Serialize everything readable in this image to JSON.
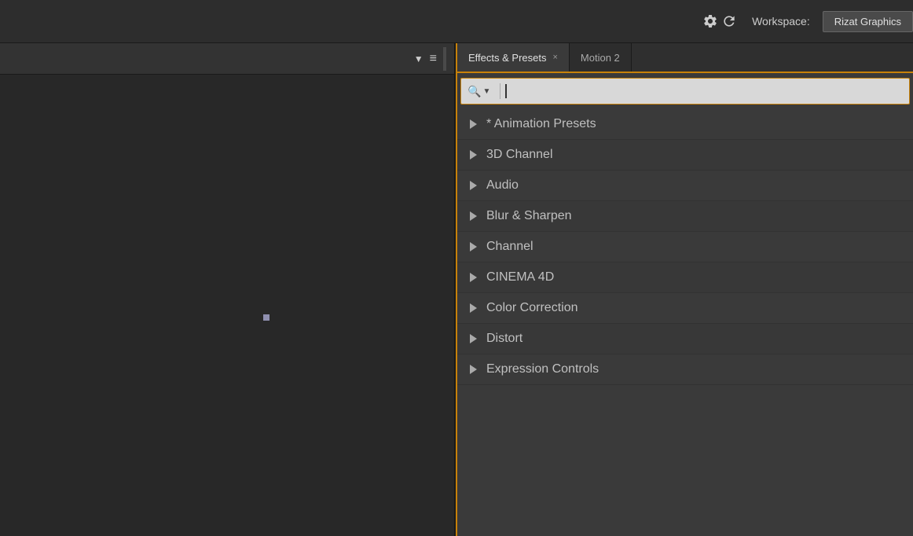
{
  "header": {
    "workspace_label": "Workspace:",
    "workspace_button": "Rizat Graphics",
    "gear_icon": "⚙",
    "refresh_icon": "↺"
  },
  "left_panel": {
    "menu_icon": "▼",
    "list_icon": "≡"
  },
  "tabs": [
    {
      "id": "effects",
      "label": "Effects & Presets",
      "active": true,
      "closable": true
    },
    {
      "id": "motion2",
      "label": "Motion 2",
      "active": false,
      "closable": false
    }
  ],
  "search": {
    "placeholder": "",
    "search_icon": "🔍",
    "dropdown_arrow": "▼"
  },
  "effects_list": [
    {
      "id": "animation-presets",
      "label": "* Animation Presets"
    },
    {
      "id": "3d-channel",
      "label": "3D Channel"
    },
    {
      "id": "audio",
      "label": "Audio"
    },
    {
      "id": "blur-sharpen",
      "label": "Blur & Sharpen"
    },
    {
      "id": "channel",
      "label": "Channel"
    },
    {
      "id": "cinema-4d",
      "label": "CINEMA 4D"
    },
    {
      "id": "color-correction",
      "label": "Color Correction"
    },
    {
      "id": "distort",
      "label": "Distort"
    },
    {
      "id": "expression-controls",
      "label": "Expression Controls"
    }
  ],
  "colors": {
    "accent": "#c8820a",
    "background_dark": "#282828",
    "background_panel": "#3a3a3a",
    "text_primary": "#c0c0c0",
    "tab_active_bg": "#3a3a3a",
    "tab_inactive_bg": "#2d2d2d"
  }
}
